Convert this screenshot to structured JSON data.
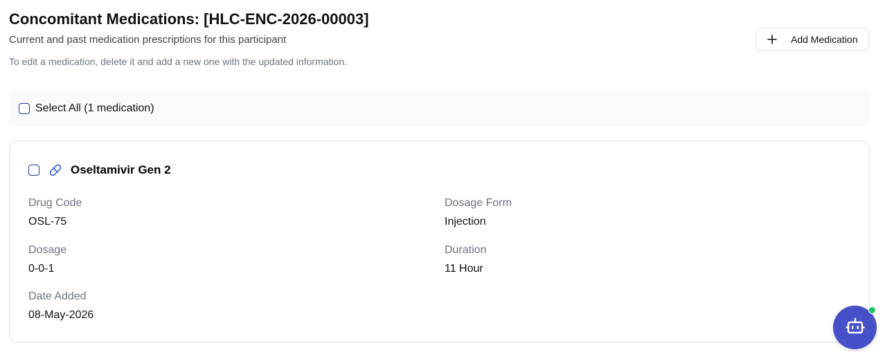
{
  "header": {
    "title": "Concomitant Medications: [HLC-ENC-2026-00003]",
    "subtitle": "Current and past medication prescriptions for this participant",
    "hint": "To edit a medication, delete it and add a new one with the updated information."
  },
  "toolbar": {
    "add_label": "Add Medication",
    "add_icon": "plus-icon"
  },
  "select_all": {
    "label": "Select All (1 medication)",
    "checked": false
  },
  "medications": [
    {
      "name": "Oseltamivir Gen 2",
      "icon": "pill-icon",
      "checked": false,
      "fields": {
        "drug_code": {
          "label": "Drug Code",
          "value": "OSL-75"
        },
        "dosage_form": {
          "label": "Dosage Form",
          "value": "Injection"
        },
        "dosage": {
          "label": "Dosage",
          "value": "0-0-1"
        },
        "duration": {
          "label": "Duration",
          "value": "11 Hour"
        },
        "date_added": {
          "label": "Date Added",
          "value": "08-May-2026"
        }
      }
    }
  ],
  "assistant": {
    "icon": "robot-icon",
    "status": "online",
    "accent_color": "#4650c9",
    "status_color": "#22c55e"
  }
}
